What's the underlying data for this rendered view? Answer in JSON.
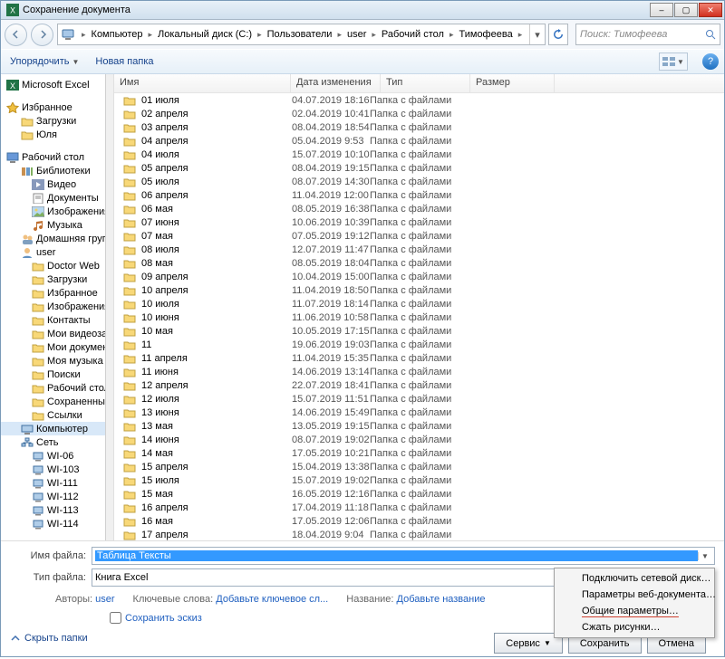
{
  "title": "Сохранение документа",
  "window_controls": {
    "min": "–",
    "max": "▢",
    "close": "✕"
  },
  "breadcrumb": [
    "Компьютер",
    "Локальный диск (C:)",
    "Пользователи",
    "user",
    "Рабочий стол",
    "Тимофеева"
  ],
  "search_placeholder": "Поиск: Тимофеева",
  "toolbar": {
    "organize": "Упорядочить",
    "newfolder": "Новая папка"
  },
  "sidebar": {
    "groups": [
      {
        "head": {
          "label": "Microsoft Excel",
          "icon": "excel"
        }
      },
      {
        "head": {
          "label": "Избранное",
          "icon": "star"
        },
        "items": [
          {
            "label": "Загрузки",
            "icon": "folder"
          },
          {
            "label": "Юля",
            "icon": "folder"
          }
        ]
      },
      {
        "head": {
          "label": "Рабочий стол",
          "icon": "desktop"
        },
        "items": [
          {
            "label": "Библиотеки",
            "icon": "libs",
            "children": [
              {
                "label": "Видео",
                "icon": "video"
              },
              {
                "label": "Документы",
                "icon": "docs"
              },
              {
                "label": "Изображения",
                "icon": "pics"
              },
              {
                "label": "Музыка",
                "icon": "music"
              }
            ]
          },
          {
            "label": "Домашняя групп",
            "icon": "homegrp"
          },
          {
            "label": "user",
            "icon": "user",
            "children": [
              {
                "label": "Doctor Web",
                "icon": "folder"
              },
              {
                "label": "Загрузки",
                "icon": "folder"
              },
              {
                "label": "Избранное",
                "icon": "folder"
              },
              {
                "label": "Изображения",
                "icon": "folder"
              },
              {
                "label": "Контакты",
                "icon": "folder"
              },
              {
                "label": "Мои видеозапи",
                "icon": "folder"
              },
              {
                "label": "Мои документы",
                "icon": "folder"
              },
              {
                "label": "Моя музыка",
                "icon": "folder"
              },
              {
                "label": "Поиски",
                "icon": "folder"
              },
              {
                "label": "Рабочий стол",
                "icon": "folder"
              },
              {
                "label": "Сохраненные и",
                "icon": "folder"
              },
              {
                "label": "Ссылки",
                "icon": "folder"
              }
            ]
          },
          {
            "label": "Компьютер",
            "icon": "computer",
            "sel": true
          },
          {
            "label": "Сеть",
            "icon": "network",
            "children": [
              {
                "label": "WI-06",
                "icon": "pc"
              },
              {
                "label": "WI-103",
                "icon": "pc"
              },
              {
                "label": "WI-111",
                "icon": "pc"
              },
              {
                "label": "WI-112",
                "icon": "pc"
              },
              {
                "label": "WI-113",
                "icon": "pc"
              },
              {
                "label": "WI-114",
                "icon": "pc"
              }
            ]
          }
        ]
      }
    ]
  },
  "columns": {
    "name": "Имя",
    "date": "Дата изменения",
    "type": "Тип",
    "size": "Размер"
  },
  "file_type": "Папка с файлами",
  "files": [
    {
      "name": "01 июля",
      "date": "04.07.2019 18:16"
    },
    {
      "name": "02 апреля",
      "date": "02.04.2019 10:41"
    },
    {
      "name": "03 апреля",
      "date": "08.04.2019 18:54"
    },
    {
      "name": "04 апреля",
      "date": "05.04.2019 9:53"
    },
    {
      "name": "04 июля",
      "date": "15.07.2019 10:10"
    },
    {
      "name": "05 апреля",
      "date": "08.04.2019 19:15"
    },
    {
      "name": "05 июля",
      "date": "08.07.2019 14:30"
    },
    {
      "name": "06 апреля",
      "date": "11.04.2019 12:00"
    },
    {
      "name": "06 мая",
      "date": "08.05.2019 16:38"
    },
    {
      "name": "07 июня",
      "date": "10.06.2019 10:39"
    },
    {
      "name": "07 мая",
      "date": "07.05.2019 19:12"
    },
    {
      "name": "08 июля",
      "date": "12.07.2019 11:47"
    },
    {
      "name": "08 мая",
      "date": "08.05.2019 18:04"
    },
    {
      "name": "09 апреля",
      "date": "10.04.2019 15:00"
    },
    {
      "name": "10 апреля",
      "date": "11.04.2019 18:50"
    },
    {
      "name": "10 июля",
      "date": "11.07.2019 18:14"
    },
    {
      "name": "10 июня",
      "date": "11.06.2019 10:58"
    },
    {
      "name": "10 мая",
      "date": "10.05.2019 17:15"
    },
    {
      "name": "11",
      "date": "19.06.2019 19:03"
    },
    {
      "name": "11 апреля",
      "date": "11.04.2019 15:35"
    },
    {
      "name": "11 июня",
      "date": "14.06.2019 13:14"
    },
    {
      "name": "12 апреля",
      "date": "22.07.2019 18:41"
    },
    {
      "name": "12 июля",
      "date": "15.07.2019 11:51"
    },
    {
      "name": "13 июня",
      "date": "14.06.2019 15:49"
    },
    {
      "name": "13 мая",
      "date": "13.05.2019 19:15"
    },
    {
      "name": "14 июня",
      "date": "08.07.2019 19:02"
    },
    {
      "name": "14 мая",
      "date": "17.05.2019 10:21"
    },
    {
      "name": "15 апреля",
      "date": "15.04.2019 13:38"
    },
    {
      "name": "15 июля",
      "date": "15.07.2019 19:02"
    },
    {
      "name": "15 мая",
      "date": "16.05.2019 12:16"
    },
    {
      "name": "16 апреля",
      "date": "17.04.2019 11:18"
    },
    {
      "name": "16 мая",
      "date": "17.05.2019 12:06"
    },
    {
      "name": "17 апреля",
      "date": "18.04.2019 9:04"
    }
  ],
  "bottom": {
    "filename_label": "Имя файла:",
    "filename_value": "Таблица Тексты",
    "filetype_label": "Тип файла:",
    "filetype_value": "Книга Excel",
    "authors_label": "Авторы:",
    "authors_value": "user",
    "keywords_label": "Ключевые слова:",
    "keywords_value": "Добавьте ключевое сл...",
    "title_label": "Название:",
    "title_value": "Добавьте название",
    "save_thumb": "Сохранить эскиз",
    "tools": "Сервис",
    "save": "Сохранить",
    "cancel": "Отмена",
    "hide_panes": "Скрыть папки"
  },
  "context_menu": [
    "Подключить сетевой диск…",
    "Параметры веб-документа…",
    "Общие параметры…",
    "Сжать рисунки…"
  ]
}
